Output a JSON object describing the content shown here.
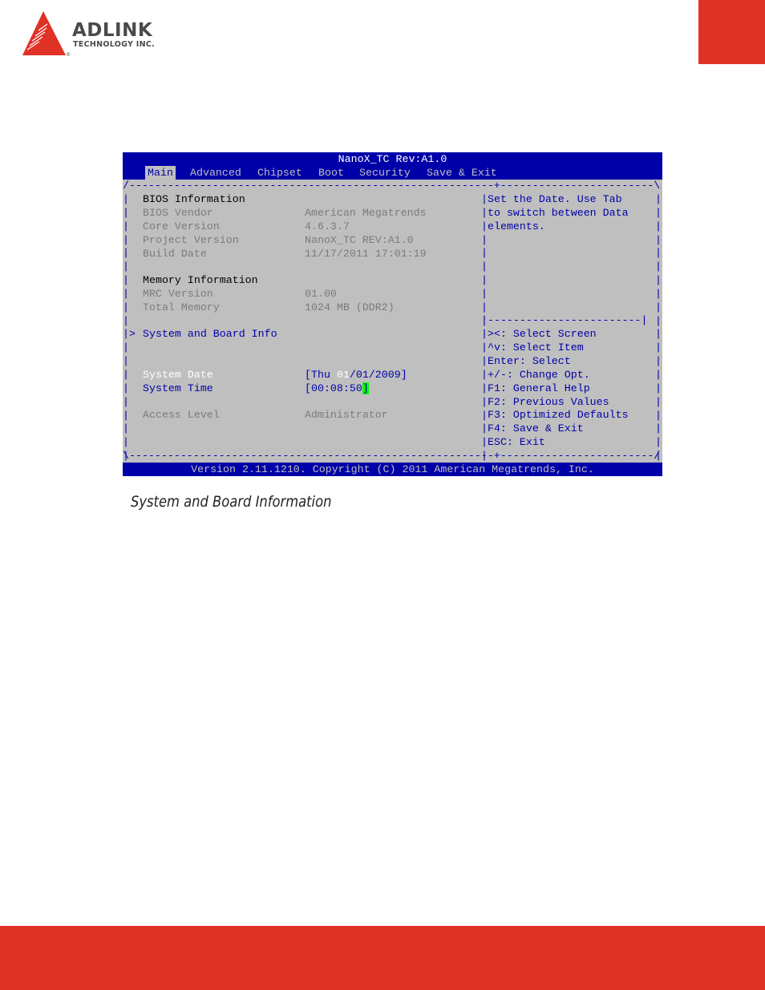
{
  "header": {
    "brand_name": "ADLINK",
    "brand_sub": "TECHNOLOGY INC.",
    "brand_reg": "®"
  },
  "colors": {
    "brand_red": "#e03127",
    "bios_blue": "#0000a8",
    "bios_gray": "#bfbfbf",
    "cursor_green": "#00ff00"
  },
  "bios": {
    "title": "NanoX_TC Rev:A1.0",
    "menu": [
      "Main",
      "Advanced",
      "Chipset",
      "Boot",
      "Security",
      "Save & Exit"
    ],
    "active_menu": "Main",
    "bios_info_heading": "BIOS Information",
    "bios_info": [
      {
        "label": "BIOS Vendor",
        "value": "American Megatrends"
      },
      {
        "label": "Core Version",
        "value": "4.6.3.7"
      },
      {
        "label": "Project Version",
        "value": "NanoX_TC REV:A1.0"
      },
      {
        "label": "Build Date",
        "value": "11/17/2011 17:01:19"
      }
    ],
    "memory_heading": "Memory Information",
    "memory_info": [
      {
        "label": "MRC Version",
        "value": "01.00"
      },
      {
        "label": "Total Memory",
        "value": "1024 MB (DDR2)"
      }
    ],
    "submenu_marker": ">",
    "submenu_label": "System and Board Info",
    "system_date_label": "System Date",
    "system_date": {
      "open": "[Thu ",
      "month": "01",
      "rest": "/01/2009]"
    },
    "system_time_label": "System Time",
    "system_time": {
      "value": "[00:08:50",
      "close": "]"
    },
    "access_level_label": "Access Level",
    "access_level_value": "Administrator",
    "help_text": [
      "Set the Date. Use Tab",
      "to switch between Data",
      "elements."
    ],
    "keys": [
      "><: Select Screen",
      "^v: Select Item",
      "Enter: Select",
      "+/-: Change Opt.",
      "F1: General Help",
      "F2: Previous Values",
      "F3: Optimized Defaults",
      "F4: Save & Exit",
      "ESC: Exit"
    ],
    "footer": "Version 2.11.1210. Copyright (C) 2011 American Megatrends, Inc."
  },
  "caption": "System and Board Information"
}
